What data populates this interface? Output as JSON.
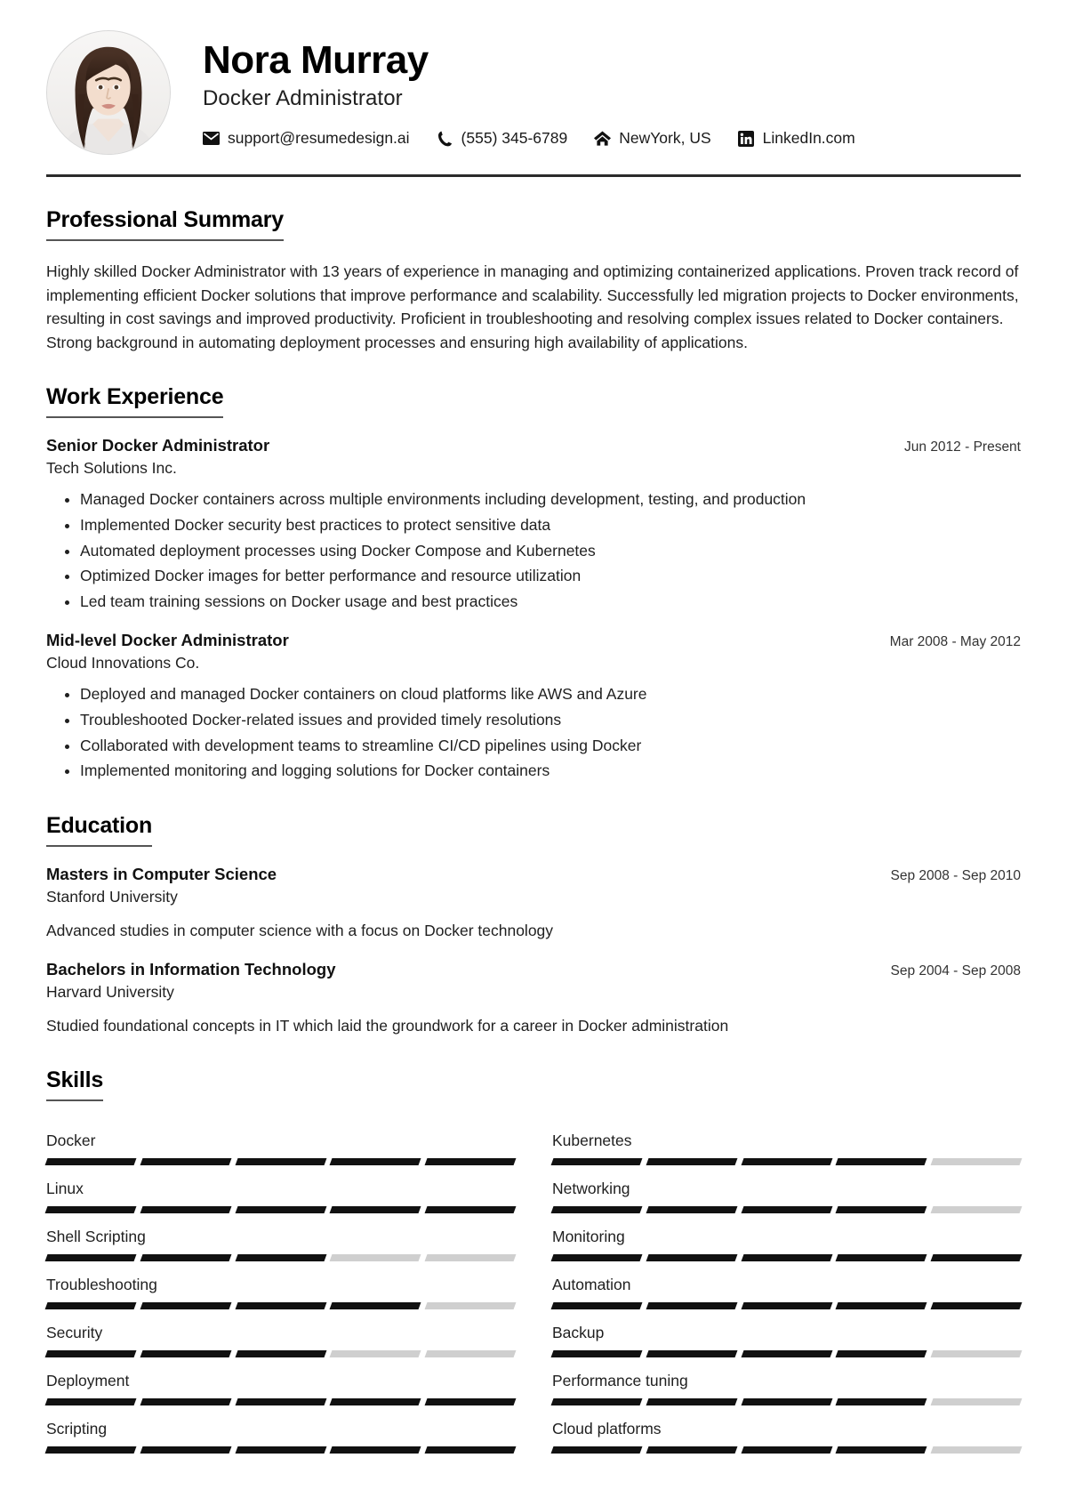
{
  "header": {
    "name": "Nora Murray",
    "role": "Docker Administrator",
    "avatar_alt": "profile-photo",
    "contacts": [
      {
        "icon": "envelope-icon",
        "label": "support@resumedesign.ai",
        "name": "contact-email"
      },
      {
        "icon": "phone-icon",
        "label": "(555) 345-6789",
        "name": "contact-phone"
      },
      {
        "icon": "home-icon",
        "label": "NewYork, US",
        "name": "contact-location"
      },
      {
        "icon": "linkedin-icon",
        "label": "LinkedIn.com",
        "name": "contact-linkedin"
      }
    ]
  },
  "summary": {
    "title": "Professional Summary",
    "text": "Highly skilled Docker Administrator with 13 years of experience in managing and optimizing containerized applications. Proven track record of implementing efficient Docker solutions that improve performance and scalability. Successfully led migration projects to Docker environments, resulting in cost savings and improved productivity. Proficient in troubleshooting and resolving complex issues related to Docker containers. Strong background in automating deployment processes and ensuring high availability of applications."
  },
  "experience": {
    "title": "Work Experience",
    "items": [
      {
        "job_title": "Senior Docker Administrator",
        "date": "Jun 2012 - Present",
        "company": "Tech Solutions Inc.",
        "bullets": [
          "Managed Docker containers across multiple environments including development, testing, and production",
          "Implemented Docker security best practices to protect sensitive data",
          "Automated deployment processes using Docker Compose and Kubernetes",
          "Optimized Docker images for better performance and resource utilization",
          "Led team training sessions on Docker usage and best practices"
        ]
      },
      {
        "job_title": "Mid-level Docker Administrator",
        "date": "Mar 2008 - May 2012",
        "company": "Cloud Innovations Co.",
        "bullets": [
          "Deployed and managed Docker containers on cloud platforms like AWS and Azure",
          "Troubleshooted Docker-related issues and provided timely resolutions",
          "Collaborated with development teams to streamline CI/CD pipelines using Docker",
          "Implemented monitoring and logging solutions for Docker containers"
        ]
      }
    ]
  },
  "education": {
    "title": "Education",
    "items": [
      {
        "degree": "Masters in Computer Science",
        "date": "Sep 2008 - Sep 2010",
        "school": "Stanford University",
        "description": "Advanced studies in computer science with a focus on Docker technology"
      },
      {
        "degree": "Bachelors in Information Technology",
        "date": "Sep 2004 - Sep 2008",
        "school": "Harvard University",
        "description": "Studied foundational concepts in IT which laid the groundwork for a career in Docker administration"
      }
    ]
  },
  "skills": {
    "title": "Skills",
    "max_level": 5,
    "filled_color": "#111111",
    "empty_color": "#cfcfcf",
    "items": [
      {
        "name": "Docker",
        "level": 5
      },
      {
        "name": "Kubernetes",
        "level": 4
      },
      {
        "name": "Linux",
        "level": 5
      },
      {
        "name": "Networking",
        "level": 4
      },
      {
        "name": "Shell Scripting",
        "level": 3
      },
      {
        "name": "Monitoring",
        "level": 5
      },
      {
        "name": "Troubleshooting",
        "level": 4
      },
      {
        "name": "Automation",
        "level": 5
      },
      {
        "name": "Security",
        "level": 3
      },
      {
        "name": "Backup",
        "level": 4
      },
      {
        "name": "Deployment",
        "level": 5
      },
      {
        "name": "Performance tuning",
        "level": 4
      },
      {
        "name": "Scripting",
        "level": 5
      },
      {
        "name": "Cloud platforms",
        "level": 4
      }
    ]
  }
}
